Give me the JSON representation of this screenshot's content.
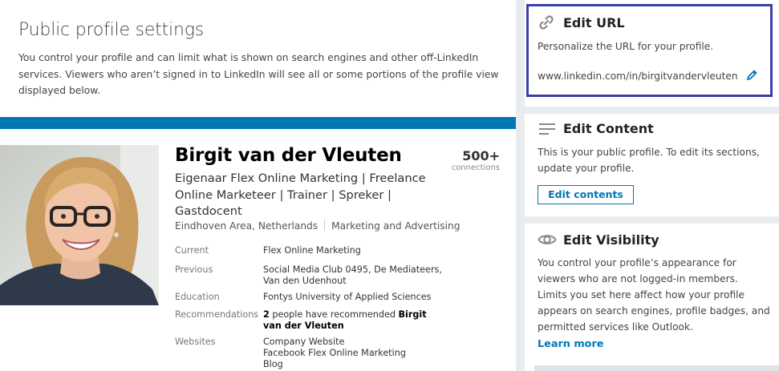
{
  "header": {
    "title": "Public profile settings",
    "description": "You control your profile and can limit what is shown on search engines and other off-LinkedIn services. Viewers who aren’t signed in to LinkedIn will see all or some portions of the profile view displayed below."
  },
  "profile": {
    "name": "Birgit van der Vleuten",
    "connections_count": "500+",
    "connections_label": "connections",
    "headline": "Eigenaar Flex Online Marketing | Freelance Online Marketeer | Trainer | Spreker | Gastdocent",
    "location": "Eindhoven Area, Netherlands",
    "industry": "Marketing and Advertising",
    "details": {
      "current": {
        "label": "Current",
        "value": "Flex Online Marketing"
      },
      "previous": {
        "label": "Previous",
        "value": "Social Media Club 0495, De Mediateers, Van den Udenhout"
      },
      "education": {
        "label": "Education",
        "value": "Fontys University of Applied Sciences"
      },
      "recommendations": {
        "label": "Recommendations",
        "count": "2",
        "text_mid": " people have recommended ",
        "name": "Birgit van der Vleuten"
      },
      "websites": {
        "label": "Websites",
        "items": [
          "Company Website",
          "Facebook Flex Online Marketing",
          "Blog"
        ]
      }
    }
  },
  "sidebar": {
    "edit_url": {
      "title": "Edit URL",
      "description": "Personalize the URL for your profile.",
      "url": "www.linkedin.com/in/birgitvandervleuten",
      "icon": "link-icon",
      "edit_icon": "pencil-icon"
    },
    "edit_content": {
      "title": "Edit Content",
      "description": "This is your public profile. To edit its sections, update your profile.",
      "button_label": "Edit contents",
      "icon": "lines-icon"
    },
    "edit_visibility": {
      "title": "Edit Visibility",
      "description": "You control your profile’s appearance for viewers who are not logged-in members. Limits you set here affect how your profile appears on search engines, profile badges, and permitted services like Outlook.",
      "link_label": "Learn more",
      "icon": "eye-icon"
    }
  },
  "colors": {
    "accent": "#0077b5",
    "highlight_border": "#3a3fa8",
    "background": "#e9ecef"
  }
}
